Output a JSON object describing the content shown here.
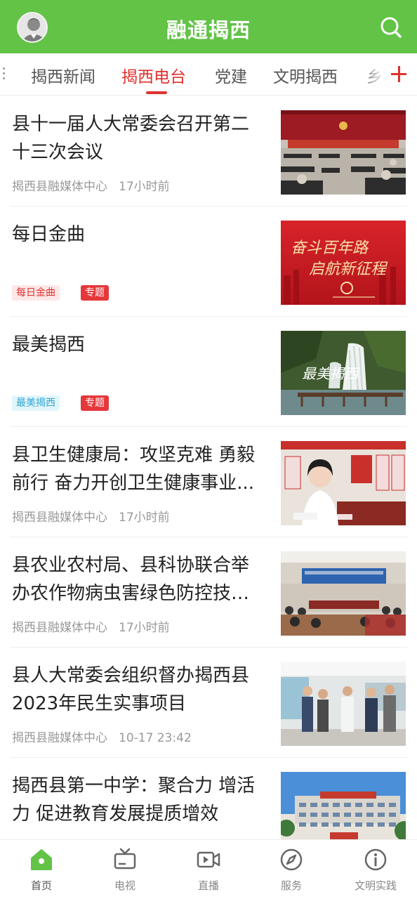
{
  "header": {
    "title": "融通揭西",
    "avatar_icon": "user-avatar-icon",
    "search_icon": "search-icon",
    "color": "#62c346"
  },
  "tabs": {
    "items": [
      {
        "label": "揭西新闻",
        "active": false
      },
      {
        "label": "揭西电台",
        "active": true
      },
      {
        "label": "党建",
        "active": false
      },
      {
        "label": "文明揭西",
        "active": false
      },
      {
        "label": "乡村",
        "active": false
      }
    ],
    "active_color": "#e0312f",
    "add_icon": "plus-icon"
  },
  "news": [
    {
      "title": "县十一届人大常委会召开第二十三次会议",
      "source": "揭西县融媒体中心",
      "time": "17小时前"
    },
    {
      "title": "每日金曲",
      "tags": [
        "每日金曲",
        "专题"
      ],
      "thumb_text": [
        "奋斗百年路",
        "启航新征程"
      ]
    },
    {
      "title": "最美揭西",
      "tags": [
        "最美揭西",
        "专题"
      ],
      "thumb_text": "最美揭西"
    },
    {
      "title": "县卫生健康局：攻坚克难 勇毅前行 奋力开创卫生健康事业...",
      "source": "揭西县融媒体中心",
      "time": "17小时前"
    },
    {
      "title": "县农业农村局、县科协联合举办农作物病虫害绿色防控技术...",
      "source": "揭西县融媒体中心",
      "time": "17小时前"
    },
    {
      "title": "县人大常委会组织督办揭西县2023年民生实事项目",
      "source": "揭西县融媒体中心",
      "time": "10-17 23:42"
    },
    {
      "title": "揭西县第一中学：聚合力 增活力 促进教育发展提质增效"
    }
  ],
  "bottom_nav": [
    {
      "label": "首页",
      "icon": "home-icon",
      "active": true
    },
    {
      "label": "电视",
      "icon": "tv-icon",
      "active": false
    },
    {
      "label": "直播",
      "icon": "live-video-icon",
      "active": false
    },
    {
      "label": "服务",
      "icon": "compass-icon",
      "active": false
    },
    {
      "label": "文明实践",
      "icon": "info-icon",
      "active": false
    }
  ]
}
